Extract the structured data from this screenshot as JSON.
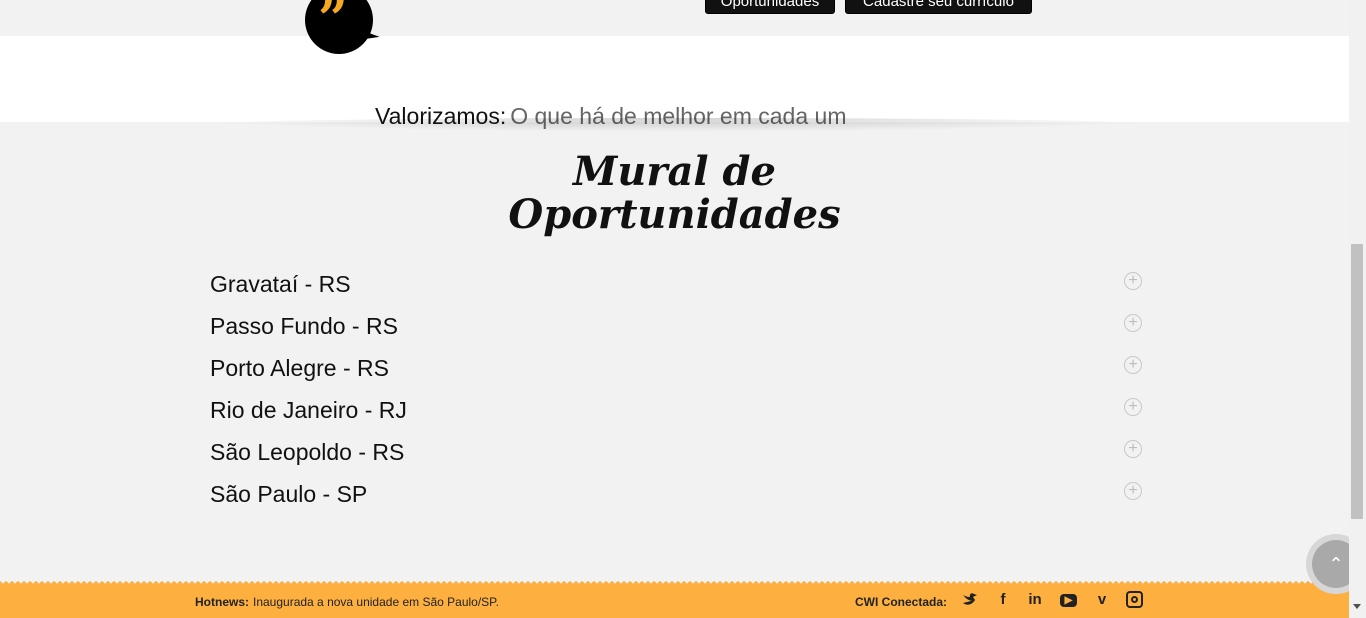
{
  "header": {
    "buttons": [
      {
        "label": "Oportunidades"
      },
      {
        "label": "Cadastre seu currículo"
      }
    ]
  },
  "quote": {
    "label": "Valorizamos:",
    "value": "O que há de melhor em cada um",
    "icon": "quote-icon",
    "accent_color": "#f7a821"
  },
  "mural": {
    "title_line1": "Mural de",
    "title_line2": "Oportunidades",
    "locations": [
      {
        "label": "Gravataí - RS"
      },
      {
        "label": "Passo Fundo - RS"
      },
      {
        "label": "Porto Alegre - RS"
      },
      {
        "label": "Rio de Janeiro - RJ"
      },
      {
        "label": "São Leopoldo - RS"
      },
      {
        "label": "São Paulo - SP"
      }
    ],
    "toggle_icon": "plus-circle-icon"
  },
  "footer": {
    "background_color": "#fdb03f",
    "hotnews_label": "Hotnews:",
    "hotnews_text": "Inaugurada a nova unidade em São Paulo/SP.",
    "connect_label": "CWI Conectada:",
    "social_icons": [
      "twitter-icon",
      "facebook-icon",
      "linkedin-icon",
      "youtube-icon",
      "vimeo-icon",
      "instagram-icon"
    ]
  },
  "scroll_top": {
    "icon": "chevron-up-icon"
  }
}
